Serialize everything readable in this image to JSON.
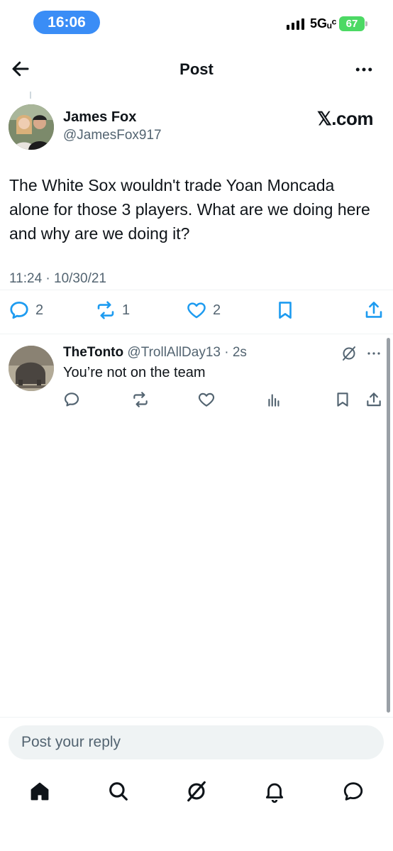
{
  "status_bar": {
    "time": "16:06",
    "network": "5Gᵤᶜ",
    "battery": "67",
    "accent_color": "#3a8df6",
    "battery_color": "#4cd964"
  },
  "nav": {
    "back_icon": "back-arrow-icon",
    "title": "Post",
    "more_icon": "more-icon"
  },
  "post": {
    "author_name": "James Fox",
    "author_handle": "@JamesFox917",
    "source_badge": "𝕏.com",
    "text": "The White Sox wouldn't trade Yoan Moncada alone for those 3 players. What are we doing here and why are we doing it?",
    "timestamp": "11:24 · 10/30/21",
    "reply_count": "2",
    "repost_count": "1",
    "like_count": "2"
  },
  "reply": {
    "name": "TheTonto",
    "handle_time": "@TrollAllDay13 · 2s",
    "text": "You’re not on the team"
  },
  "composer": {
    "placeholder": "Post your reply"
  },
  "bottom_nav": {
    "items": [
      "home-icon",
      "search-icon",
      "grok-icon",
      "notifications-icon",
      "messages-icon"
    ]
  }
}
